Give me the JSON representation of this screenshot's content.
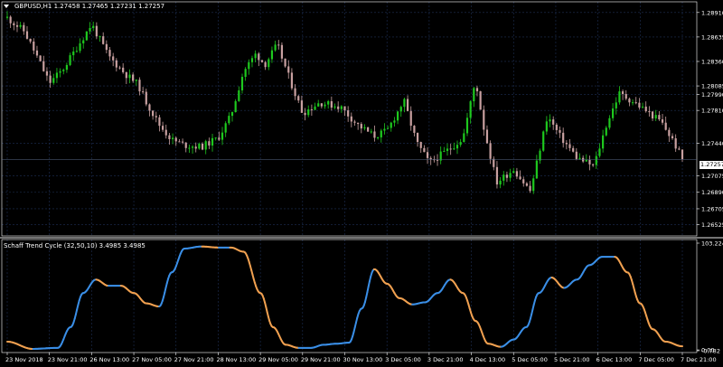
{
  "main_panel": {
    "title": "GBPUSD,H1  1.27458 1.27465 1.27231 1.27257",
    "current_price": "1.27257",
    "price_ticks": [
      "1.28910",
      "1.28635",
      "1.28360",
      "1.28085",
      "1.27990",
      "1.27810",
      "1.27440",
      "1.27075",
      "1.26890",
      "1.26705",
      "1.26525"
    ]
  },
  "indicator_panel": {
    "title": "Schaff Trend Cycle (32,50,10) 3.4985 3.4985",
    "ticks": [
      "103.2243",
      "0.00",
      "-0.782"
    ]
  },
  "time_axis": [
    "23 Nov 2018",
    "23 Nov 21:00",
    "26 Nov 13:00",
    "27 Nov 05:00",
    "27 Nov 21:00",
    "28 Nov 13:00",
    "29 Nov 05:00",
    "29 Nov 21:00",
    "30 Nov 13:00",
    "3 Dec 05:00",
    "3 Dec 21:00",
    "4 Dec 13:00",
    "5 Dec 05:00",
    "5 Dec 21:00",
    "6 Dec 13:00",
    "7 Dec 05:00",
    "7 Dec 21:00"
  ],
  "colors": {
    "background": "#000000",
    "grid": "#1e2f55",
    "bull_candle": "#1ec81e",
    "bear_candle": "#c8a0a0",
    "stc_rising": "#3a8ee6",
    "stc_falling": "#f0a050",
    "axis_text": "#ffffff"
  },
  "chart_data": [
    {
      "type": "candlestick",
      "title": "GBPUSD,H1  1.27458 1.27465 1.27231 1.27257",
      "ylim": [
        1.264,
        1.2903
      ],
      "x": [
        "23 Nov 2018",
        "23 Nov 21:00",
        "26 Nov 13:00",
        "27 Nov 05:00",
        "27 Nov 21:00",
        "28 Nov 13:00",
        "29 Nov 05:00",
        "29 Nov 21:00",
        "30 Nov 13:00",
        "3 Dec 05:00",
        "3 Dec 21:00",
        "4 Dec 13:00",
        "5 Dec 05:00",
        "5 Dec 21:00",
        "6 Dec 13:00",
        "7 Dec 05:00",
        "7 Dec 21:00"
      ],
      "close_path": [
        [
          0,
          1.2885
        ],
        [
          0.4,
          1.287
        ],
        [
          0.7,
          1.2842
        ],
        [
          1.0,
          1.2812
        ],
        [
          1.3,
          1.2826
        ],
        [
          1.6,
          1.2848
        ],
        [
          2.0,
          1.2878
        ],
        [
          2.4,
          1.2842
        ],
        [
          2.8,
          1.2822
        ],
        [
          3.1,
          1.281
        ],
        [
          3.3,
          1.279
        ],
        [
          3.6,
          1.2765
        ],
        [
          3.9,
          1.2748
        ],
        [
          4.2,
          1.2742
        ],
        [
          4.6,
          1.274
        ],
        [
          5.0,
          1.275
        ],
        [
          5.3,
          1.2775
        ],
        [
          5.6,
          1.2825
        ],
        [
          5.9,
          1.2845
        ],
        [
          6.1,
          1.2832
        ],
        [
          6.4,
          1.2855
        ],
        [
          6.7,
          1.2815
        ],
        [
          7.0,
          1.2778
        ],
        [
          7.4,
          1.279
        ],
        [
          7.9,
          1.2785
        ],
        [
          8.3,
          1.2765
        ],
        [
          8.7,
          1.2752
        ],
        [
          9.0,
          1.2758
        ],
        [
          9.4,
          1.2792
        ],
        [
          9.7,
          1.2745
        ],
        [
          10.0,
          1.2722
        ],
        [
          10.4,
          1.2735
        ],
        [
          10.8,
          1.275
        ],
        [
          11.1,
          1.2815
        ],
        [
          11.3,
          1.276
        ],
        [
          11.6,
          1.27
        ],
        [
          12.0,
          1.2715
        ],
        [
          12.4,
          1.269
        ],
        [
          12.8,
          1.2775
        ],
        [
          13.1,
          1.2752
        ],
        [
          13.5,
          1.2728
        ],
        [
          13.9,
          1.2718
        ],
        [
          14.2,
          1.2765
        ],
        [
          14.5,
          1.28
        ],
        [
          14.8,
          1.2792
        ],
        [
          15.1,
          1.2782
        ],
        [
          15.5,
          1.2768
        ],
        [
          15.8,
          1.2745
        ],
        [
          16.0,
          1.2726
        ]
      ]
    },
    {
      "type": "line",
      "title": "Schaff Trend Cycle (32,50,10) 3.4985 3.4985",
      "ylim": [
        -0.782,
        103.2243
      ],
      "series": [
        {
          "name": "Schaff Trend Cycle (32,50,10)",
          "x": [
            0,
            0.6,
            1.2,
            1.5,
            1.8,
            2.1,
            2.4,
            2.7,
            3.0,
            3.3,
            3.6,
            3.9,
            4.2,
            4.6,
            5.0,
            5.3,
            5.6,
            6.0,
            6.3,
            6.6,
            6.9,
            7.2,
            7.5,
            7.8,
            8.1,
            8.4,
            8.7,
            9.0,
            9.3,
            9.6,
            9.9,
            10.2,
            10.5,
            10.8,
            11.1,
            11.4,
            11.7,
            12.0,
            12.3,
            12.6,
            12.9,
            13.2,
            13.5,
            13.8,
            14.1,
            14.4,
            14.7,
            15.0,
            15.3,
            15.6,
            16.0
          ],
          "values": [
            8,
            1,
            2,
            22,
            55,
            68,
            62,
            62,
            55,
            45,
            42,
            75,
            98,
            100,
            99,
            99,
            95,
            55,
            22,
            5,
            2,
            2,
            5,
            6,
            7,
            40,
            78,
            64,
            50,
            44,
            46,
            55,
            68,
            55,
            28,
            6,
            3,
            10,
            22,
            55,
            70,
            60,
            68,
            82,
            90,
            90,
            75,
            45,
            20,
            8,
            3.5
          ]
        }
      ]
    }
  ]
}
